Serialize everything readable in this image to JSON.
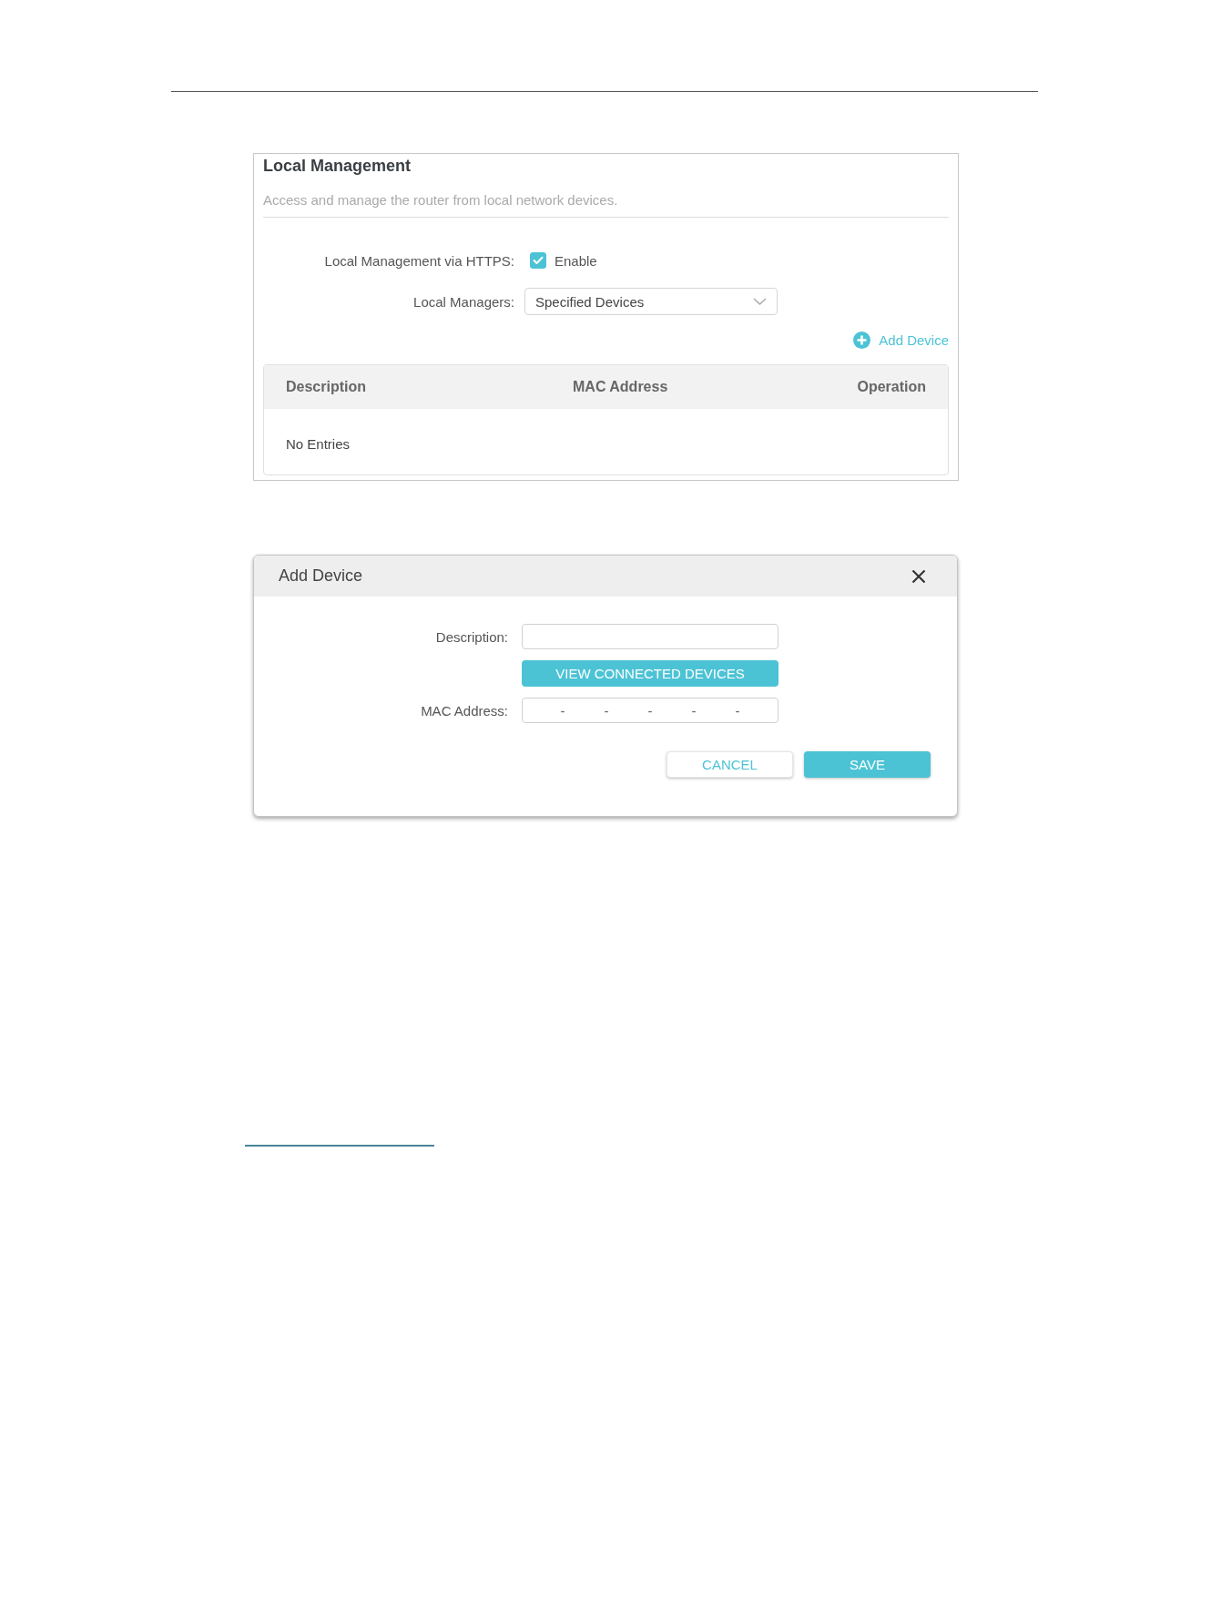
{
  "local_management": {
    "title": "Local Management",
    "description": "Access and manage the router from local network devices.",
    "https": {
      "label": "Local Management via HTTPS:",
      "checkbox_label": "Enable",
      "checked": true
    },
    "managers": {
      "label": "Local Managers:",
      "value": "Specified Devices"
    },
    "add_device_link": "Add Device",
    "table": {
      "columns": [
        "Description",
        "MAC Address",
        "Operation"
      ],
      "empty_text": "No Entries"
    }
  },
  "add_device_dialog": {
    "title": "Add Device",
    "fields": [
      {
        "kind": "text",
        "label": "Description:"
      },
      {
        "kind": "button",
        "label": "VIEW CONNECTED DEVICES"
      },
      {
        "kind": "mac",
        "label": "MAC Address:",
        "separators": [
          "-",
          "-",
          "-",
          "-",
          "-"
        ]
      }
    ],
    "buttons": [
      {
        "kind": "secondary",
        "label": "CANCEL"
      },
      {
        "kind": "primary",
        "label": "SAVE"
      }
    ]
  }
}
